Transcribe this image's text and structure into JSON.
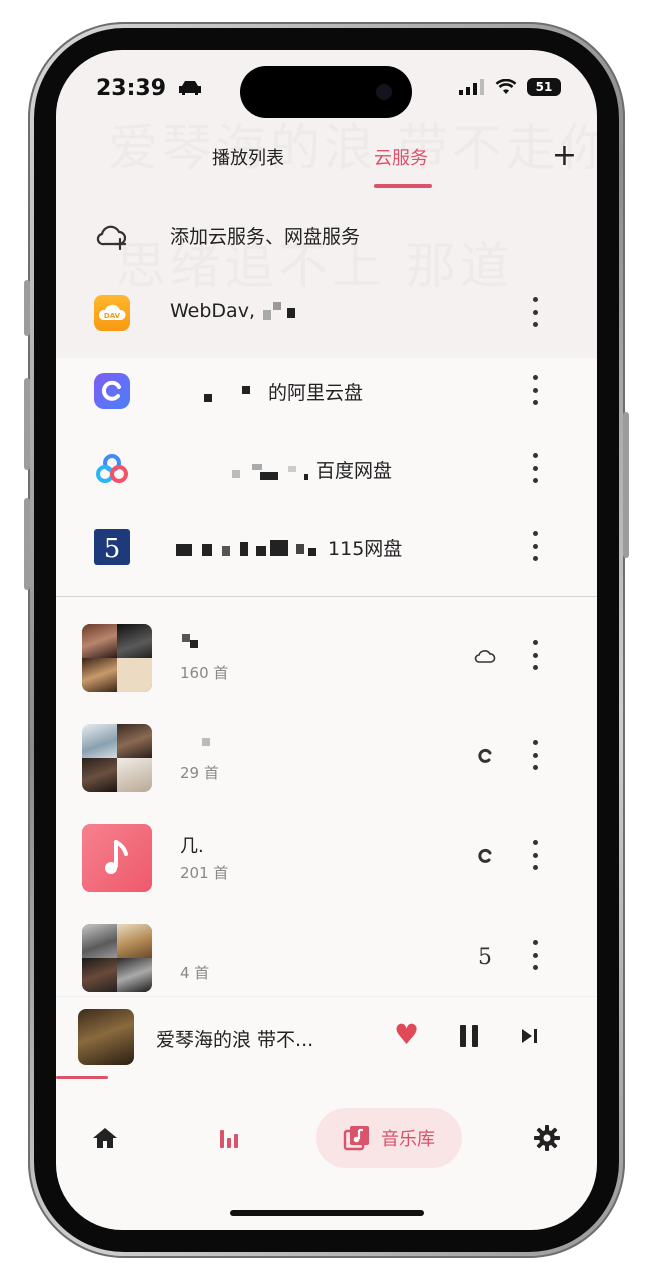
{
  "status_bar": {
    "time": "23:39",
    "battery": "51"
  },
  "background_lyrics": [
    "爱琴海的浪 带不走你",
    "思绪追不上 那道"
  ],
  "tabs": [
    {
      "label": "播放列表",
      "active": false
    },
    {
      "label": "云服务",
      "active": true
    }
  ],
  "cloud_services": {
    "add_label": "添加云服务、网盘服务",
    "items": [
      {
        "label": "WebDav,",
        "icon": "webdav-icon",
        "icon_text": "DAV"
      },
      {
        "label": "的阿里云盘",
        "icon": "aliyun-drive-icon"
      },
      {
        "label": "百度网盘",
        "icon": "baidu-netdisk-icon"
      },
      {
        "label": "115网盘",
        "icon": "115-netdisk-icon",
        "icon_text": "5"
      }
    ]
  },
  "playlists": [
    {
      "title": "",
      "count": "160 首",
      "source": "cloud-icon"
    },
    {
      "title": "",
      "count": "29 首",
      "source": "aliyun-icon"
    },
    {
      "title": "几.",
      "count": "201 首",
      "source": "aliyun-icon"
    },
    {
      "title": "",
      "count": "4 首",
      "source": "115-icon",
      "source_text": "5"
    }
  ],
  "now_playing": {
    "title": "爱琴海的浪 带不...",
    "progress": 0.1
  },
  "bottom_nav": {
    "library_label": "音乐库"
  },
  "colors": {
    "accent": "#d9536a",
    "heart": "#e04a57"
  }
}
